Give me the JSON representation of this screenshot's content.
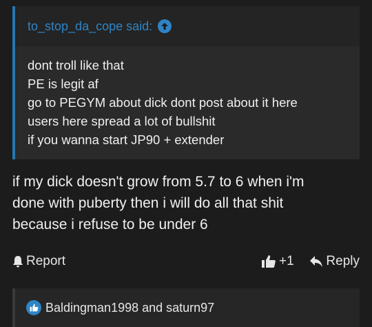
{
  "quote": {
    "header": "to_stop_da_cope said:",
    "lines": [
      "dont troll like that",
      "PE is legit af",
      "go to PEGYM about dick dont post about it here",
      "users here spread a lot of bullshit",
      "if you wanna start JP90 + extender"
    ]
  },
  "post": {
    "lines": [
      "if my dick doesn't grow from 5.7 to 6 when i'm",
      "done with puberty then i will do all that shit",
      "because i refuse to be under 6"
    ]
  },
  "actions": {
    "report_label": "Report",
    "like_label": "+1",
    "reply_label": "Reply"
  },
  "reactions": {
    "text": "Baldingman1998 and saturn97"
  },
  "colors": {
    "accent": "#2f84c6",
    "background": "#1c1c1c"
  }
}
